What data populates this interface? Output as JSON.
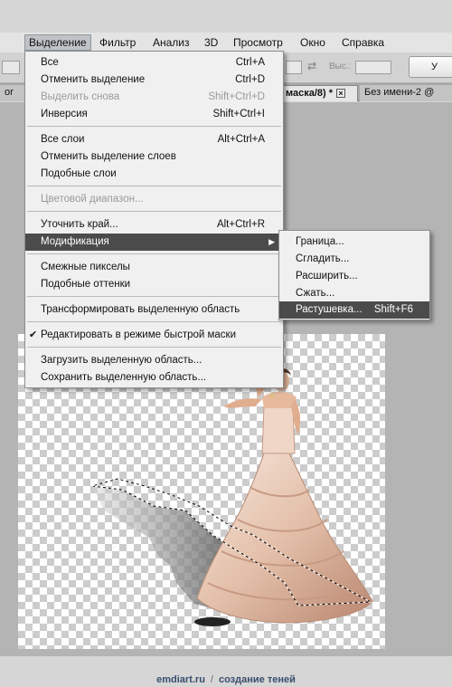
{
  "menubar": {
    "items": [
      "Выделение",
      "Фильтр",
      "Анализ",
      "3D",
      "Просмотр",
      "Окно",
      "Справка"
    ]
  },
  "options_bar": {
    "height_label": "Выс.:",
    "button_label": "У"
  },
  "tabs": {
    "left_partial": "ог",
    "active": "маска/8) *",
    "close_glyph": "×",
    "other": "Без имени-2 @"
  },
  "menu": {
    "items": [
      {
        "label": "Все",
        "shortcut": "Ctrl+A"
      },
      {
        "label": "Отменить выделение",
        "shortcut": "Ctrl+D"
      },
      {
        "label": "Выделить снова",
        "shortcut": "Shift+Ctrl+D",
        "disabled": true
      },
      {
        "label": "Инверсия",
        "shortcut": "Shift+Ctrl+I"
      },
      {
        "label": "Все слои",
        "shortcut": "Alt+Ctrl+A"
      },
      {
        "label": "Отменить выделение слоев",
        "shortcut": ""
      },
      {
        "label": "Подобные слои",
        "shortcut": ""
      },
      {
        "label": "Цветовой диапазон...",
        "shortcut": "",
        "disabled": true
      },
      {
        "label": "Уточнить край...",
        "shortcut": "Alt+Ctrl+R"
      },
      {
        "label": "Модификация",
        "shortcut": "",
        "submenu": true
      },
      {
        "label": "Смежные пикселы",
        "shortcut": ""
      },
      {
        "label": "Подобные оттенки",
        "shortcut": ""
      },
      {
        "label": "Трансформировать выделенную область",
        "shortcut": ""
      },
      {
        "label": "Редактировать в режиме быстрой маски",
        "shortcut": "",
        "checked": true
      },
      {
        "label": "Загрузить выделенную область...",
        "shortcut": ""
      },
      {
        "label": "Сохранить выделенную область...",
        "shortcut": ""
      }
    ],
    "check_glyph": "✔",
    "arrow_glyph": "▶"
  },
  "submenu": {
    "items": [
      {
        "label": "Граница...",
        "shortcut": ""
      },
      {
        "label": "Сгладить...",
        "shortcut": ""
      },
      {
        "label": "Расширить...",
        "shortcut": ""
      },
      {
        "label": "Сжать...",
        "shortcut": ""
      },
      {
        "label": "Растушевка...",
        "shortcut": "Shift+F6"
      }
    ]
  },
  "footer": {
    "site": "emdiart.ru",
    "slash": "/",
    "topic": "создание теней"
  },
  "colors": {
    "menu_highlight": "#4b4b4b",
    "menu_bg": "#f0f0f0",
    "workspace": "#b4b4b4"
  }
}
